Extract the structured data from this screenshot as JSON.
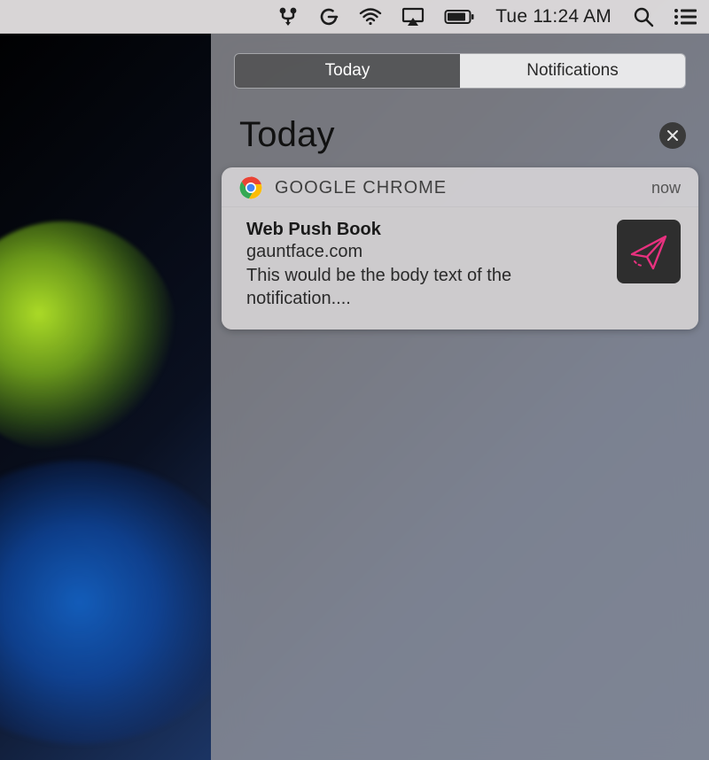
{
  "menubar": {
    "clock": "Tue 11:24 AM"
  },
  "panel": {
    "tabs": {
      "today": "Today",
      "notifications": "Notifications"
    },
    "section_title": "Today"
  },
  "notification": {
    "app_name": "GOOGLE CHROME",
    "timestamp": "now",
    "title": "Web Push Book",
    "domain": "gauntface.com",
    "body": "This would be the body text of the notification...."
  }
}
